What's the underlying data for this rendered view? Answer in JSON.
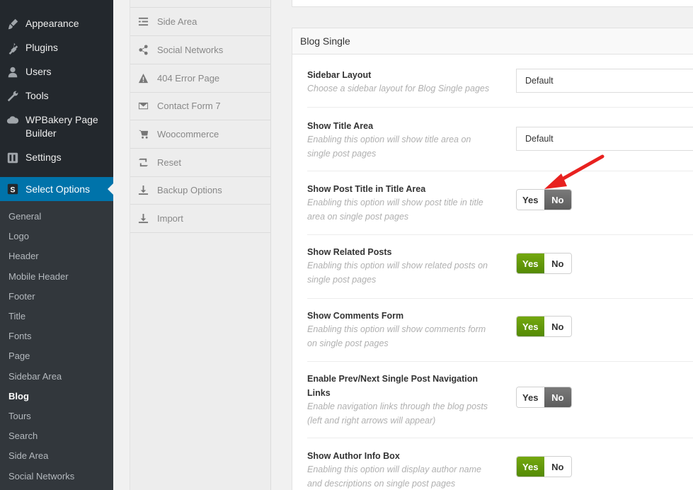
{
  "wp_menu": {
    "items": [
      {
        "label": "Appearance",
        "icon": "paintbrush-icon"
      },
      {
        "label": "Plugins",
        "icon": "plug-icon"
      },
      {
        "label": "Users",
        "icon": "user-icon"
      },
      {
        "label": "Tools",
        "icon": "wrench-icon"
      },
      {
        "label": "WPBakery Page Builder",
        "icon": "cloud-icon"
      },
      {
        "label": "Settings",
        "icon": "settings-icon"
      },
      {
        "label": "Select Options",
        "icon": "select-logo-icon"
      }
    ],
    "submenu": [
      "General",
      "Logo",
      "Header",
      "Mobile Header",
      "Footer",
      "Title",
      "Fonts",
      "Page",
      "Sidebar Area",
      "Blog",
      "Tours",
      "Search",
      "Side Area",
      "Social Networks"
    ],
    "current_submenu": "Blog",
    "accent_color": "#0073aa"
  },
  "options_nav": {
    "items": [
      {
        "label": "Side Area",
        "icon": "list-icon"
      },
      {
        "label": "Social Networks",
        "icon": "share-icon"
      },
      {
        "label": "404 Error Page",
        "icon": "warning-icon"
      },
      {
        "label": "Contact Form 7",
        "icon": "envelope-icon"
      },
      {
        "label": "Woocommerce",
        "icon": "cart-icon"
      },
      {
        "label": "Reset",
        "icon": "retweet-icon"
      },
      {
        "label": "Backup Options",
        "icon": "download-icon"
      },
      {
        "label": "Import",
        "icon": "download-icon"
      }
    ]
  },
  "panel": {
    "title": "Blog Single",
    "rows": [
      {
        "title": "Sidebar Layout",
        "desc": [
          "Choose a sidebar layout for Blog Single pages"
        ],
        "control": "select",
        "value": "Default"
      },
      {
        "title": "Show Title Area",
        "desc": [
          "Enabling this option will show title area on",
          "single post pages"
        ],
        "control": "select",
        "value": "Default"
      },
      {
        "title": "Show Post Title in Title Area",
        "desc": [
          "Enabling this option will show post title in title",
          "area on single post pages"
        ],
        "control": "toggle",
        "yes": "Yes",
        "no": "No",
        "state": "no"
      },
      {
        "title": "Show Related Posts",
        "desc": [
          "Enabling this option will show related posts on",
          "single post pages"
        ],
        "control": "toggle",
        "yes": "Yes",
        "no": "No",
        "state": "yes"
      },
      {
        "title": "Show Comments Form",
        "desc": [
          "Enabling this option will show comments form",
          "on single post pages"
        ],
        "control": "toggle",
        "yes": "Yes",
        "no": "No",
        "state": "yes"
      },
      {
        "title": "Enable Prev/Next Single Post Navigation Links",
        "desc": [
          "Enable navigation links through the blog posts",
          "(left and right arrows will appear)"
        ],
        "control": "toggle",
        "yes": "Yes",
        "no": "No",
        "state": "no"
      },
      {
        "title": "Show Author Info Box",
        "desc": [
          "Enabling this option will display author name",
          "and descriptions on single post pages"
        ],
        "control": "toggle",
        "yes": "Yes",
        "no": "No",
        "state": "yes"
      }
    ],
    "colors": {
      "yes_on": "#6a9e0c",
      "no_on": "#666666",
      "annotation_arrow": "#e8211f"
    }
  }
}
